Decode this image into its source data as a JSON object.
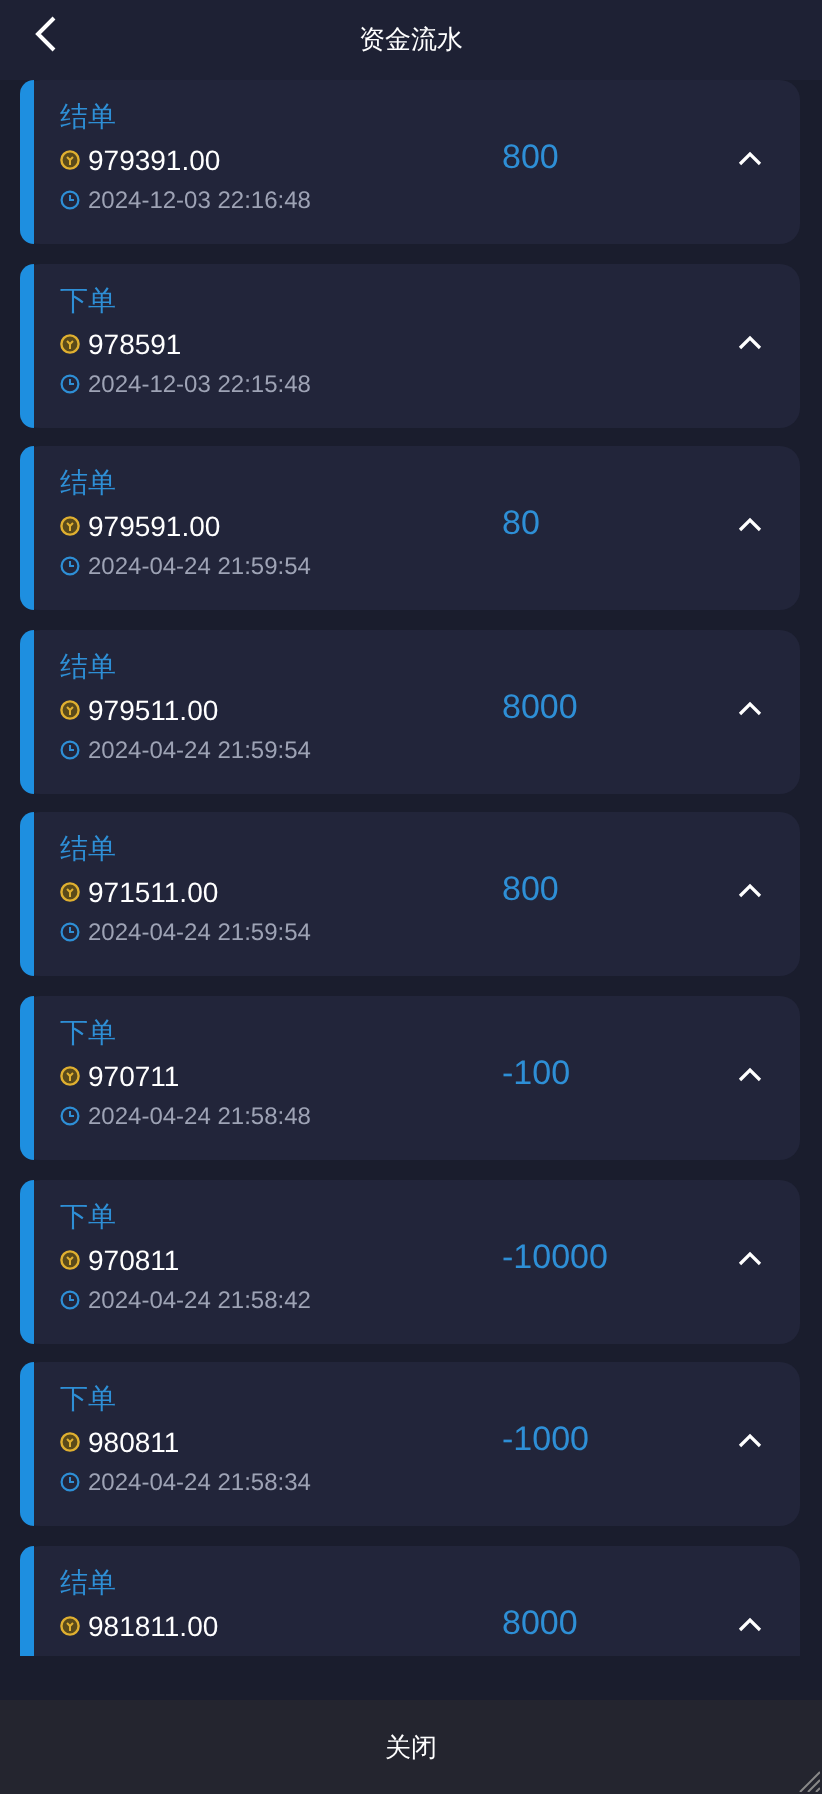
{
  "header": {
    "title": "资金流水"
  },
  "records": [
    {
      "type": "结单",
      "balance": "979391.00",
      "time": "2024-12-03 22:16:48",
      "amount": "800"
    },
    {
      "type": "下单",
      "balance": "978591",
      "time": "2024-12-03 22:15:48"
    },
    {
      "type": "结单",
      "balance": "979591.00",
      "time": "2024-04-24 21:59:54",
      "amount": "80"
    },
    {
      "type": "结单",
      "balance": "979511.00",
      "time": "2024-04-24 21:59:54",
      "amount": "8000"
    },
    {
      "type": "结单",
      "balance": "971511.00",
      "time": "2024-04-24 21:59:54",
      "amount": "800"
    },
    {
      "type": "下单",
      "balance": "970711",
      "time": "2024-04-24 21:58:48",
      "amount": "-100"
    },
    {
      "type": "下单",
      "balance": "970811",
      "time": "2024-04-24 21:58:42",
      "amount": "-10000"
    },
    {
      "type": "下单",
      "balance": "980811",
      "time": "2024-04-24 21:58:34",
      "amount": "-1000"
    },
    {
      "type": "结单",
      "balance": "981811.00",
      "amount": "8000"
    }
  ],
  "footer": {
    "close_label": "关闭"
  }
}
